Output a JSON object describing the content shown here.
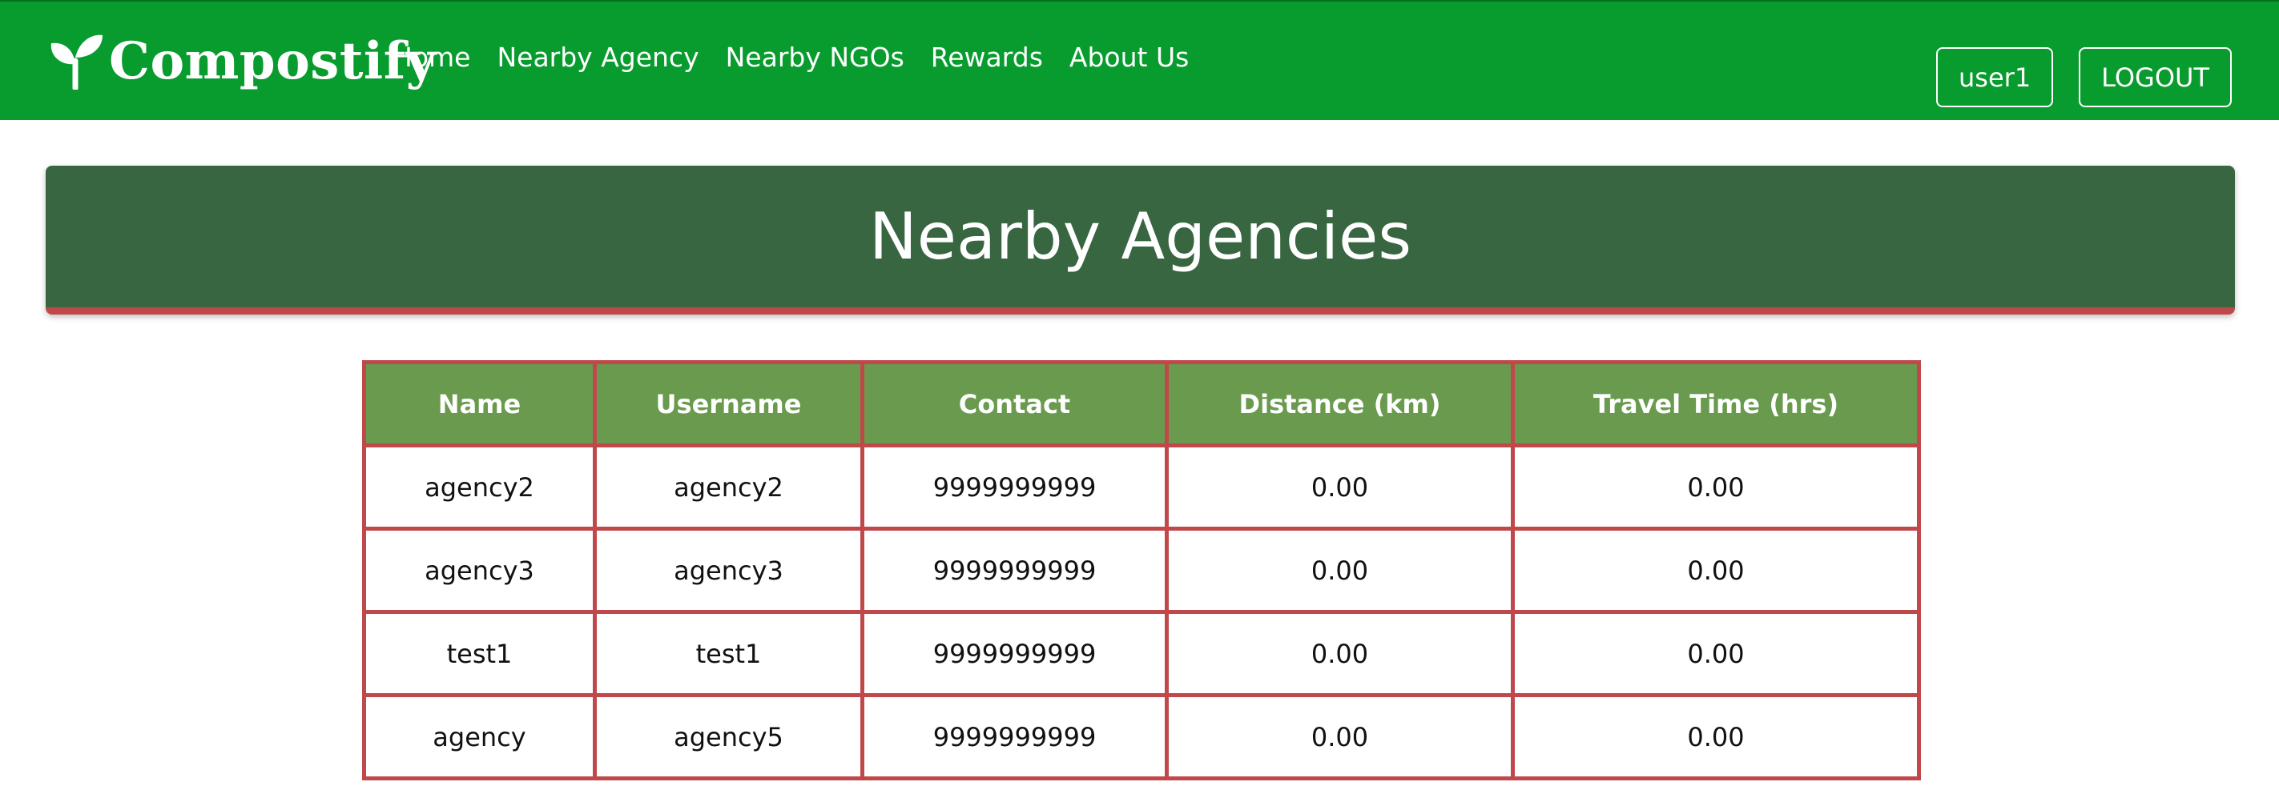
{
  "colors": {
    "navbar": "#089c2e",
    "banner": "#376641",
    "accent_red": "#c0484b",
    "table_header": "#6a9a4e"
  },
  "nav": {
    "logo_icon": "sprout-icon",
    "brand": "Compostify",
    "links": [
      "Home",
      "Nearby Agency",
      "Nearby NGOs",
      "Rewards",
      "About Us"
    ],
    "user_label": "user1",
    "logout_label": "LOGOUT"
  },
  "page": {
    "title": "Nearby Agencies"
  },
  "table": {
    "headers": [
      "Name",
      "Username",
      "Contact",
      "Distance (km)",
      "Travel Time (hrs)"
    ],
    "rows": [
      [
        "agency2",
        "agency2",
        "9999999999",
        "0.00",
        "0.00"
      ],
      [
        "agency3",
        "agency3",
        "9999999999",
        "0.00",
        "0.00"
      ],
      [
        "test1",
        "test1",
        "9999999999",
        "0.00",
        "0.00"
      ],
      [
        "agency",
        "agency5",
        "9999999999",
        "0.00",
        "0.00"
      ]
    ]
  }
}
